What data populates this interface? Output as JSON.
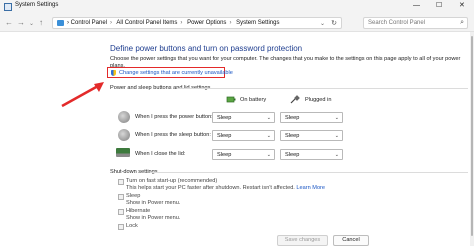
{
  "window": {
    "title": "System Settings",
    "controls": {
      "minimize": "—",
      "maximize": "☐",
      "close": "✕"
    }
  },
  "address_bar": {
    "breadcrumbs": [
      "Control Panel",
      "All Control Panel Items",
      "Power Options",
      "System Settings"
    ],
    "search_placeholder": "Search Control Panel"
  },
  "page": {
    "heading": "Define power buttons and turn on password protection",
    "description": "Choose the power settings that you want for your computer. The changes that you make to the settings on this page apply to all of your power plans.",
    "change_link": "Change settings that are currently unavailable"
  },
  "power_section": {
    "label": "Power and sleep buttons and lid settings",
    "columns": {
      "battery": "On battery",
      "plugged": "Plugged in"
    },
    "rows": [
      {
        "label": "When I press the power button:",
        "battery": "Sleep",
        "plugged": "Sleep"
      },
      {
        "label": "When I press the sleep button:",
        "battery": "Sleep",
        "plugged": "Sleep"
      },
      {
        "label": "When I close the lid:",
        "battery": "Sleep",
        "plugged": "Sleep"
      }
    ]
  },
  "shutdown_section": {
    "label": "Shut-down settings",
    "options": [
      {
        "title": "Turn on fast start-up (recommended)",
        "desc": "This helps start your PC faster after shutdown. Restart isn't affected.",
        "link": "Learn More"
      },
      {
        "title": "Sleep",
        "desc": "Show in Power menu."
      },
      {
        "title": "Hibernate",
        "desc": "Show in Power menu."
      },
      {
        "title": "Lock"
      }
    ]
  },
  "buttons": {
    "save": "Save changes",
    "cancel": "Cancel"
  },
  "colors": {
    "heading": "#1e3d8f",
    "link": "#1a56c4",
    "highlight": "#e32a2a"
  }
}
